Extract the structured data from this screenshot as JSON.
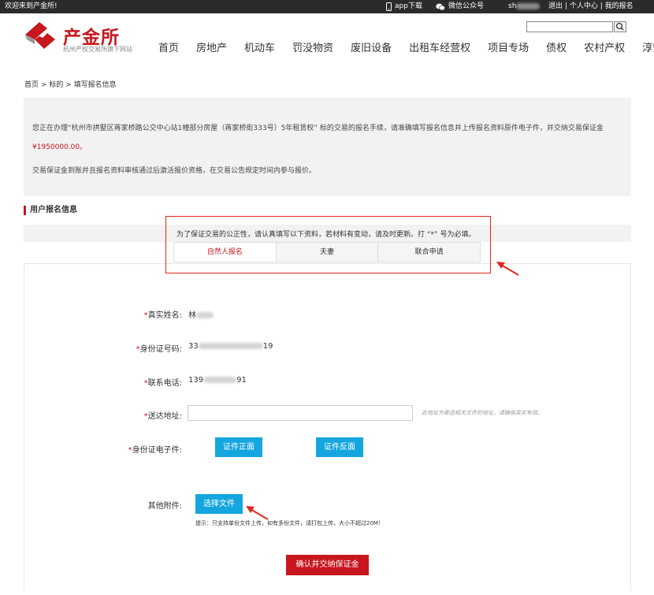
{
  "topbar": {
    "welcome": "欢迎来到产金所!",
    "app_download": "app下载",
    "wechat": "微信公众号",
    "username_prefix": "sh",
    "logout": "退出",
    "sep1": "|",
    "personal_center": "个人中心",
    "sep2": "|",
    "my_registration": "我的报名"
  },
  "logo": {
    "name": "产金所",
    "subtitle": "杭州产权交易所旗下网站"
  },
  "nav": {
    "items": [
      "首页",
      "房地产",
      "机动车",
      "罚没物资",
      "废旧设备",
      "出租车经营权",
      "项目专场",
      "债权",
      "农村产权",
      "淳安产权"
    ]
  },
  "breadcrumb": {
    "home": "首页",
    "sep": ">",
    "target": "标的",
    "current": "填写报名信息"
  },
  "info": {
    "line1": "您正在办理“杭州市拱墅区蒋家桥路公交中心站1幢部分房屋（蒋家桥街333号）5年租赁权” 标的交易的报名手续，请准确填写报名信息并上传报名资料原件电子件，并交纳交易保证金",
    "price": "¥1950000.00。",
    "line2": "交易保证金到账并且报名资料审核通过后激活报价资格，在交易公告规定时间内参与报价。"
  },
  "section": {
    "title": "用户报名信息"
  },
  "notice": "为了保证交易的公正性，请认真填写以下资料，若材料有变动，请及时更新。打 “*” 号为必填。",
  "tabs": [
    "自然人报名",
    "夫妻",
    "联合申请"
  ],
  "form": {
    "required_mark": "*",
    "name_label": "真实姓名:",
    "name_value_prefix": "林",
    "id_label": "身份证号码:",
    "id_value_prefix": "33",
    "id_value_suffix": "19",
    "phone_label": "联系电话:",
    "phone_value_prefix": "139",
    "phone_value_suffix": "91",
    "address_label": "送达地址:",
    "address_value": "",
    "address_hint": "此地址为寄送相关文件的地址，请确保真实有效。",
    "idcard_label": "身份证电子件:",
    "idcard_front": "证件正面",
    "idcard_back": "证件反面",
    "attachment_label": "其他附件:",
    "choose_file": "选择文件",
    "tip": "提示：只支持单份文件上传，如有多份文件，请打包上传，大小不超过20M！",
    "submit": "确认并交纳保证金"
  },
  "colors": {
    "brand_red": "#c7161d",
    "button_blue": "#15a6e0",
    "topbar_bg": "#2b2b2b"
  }
}
